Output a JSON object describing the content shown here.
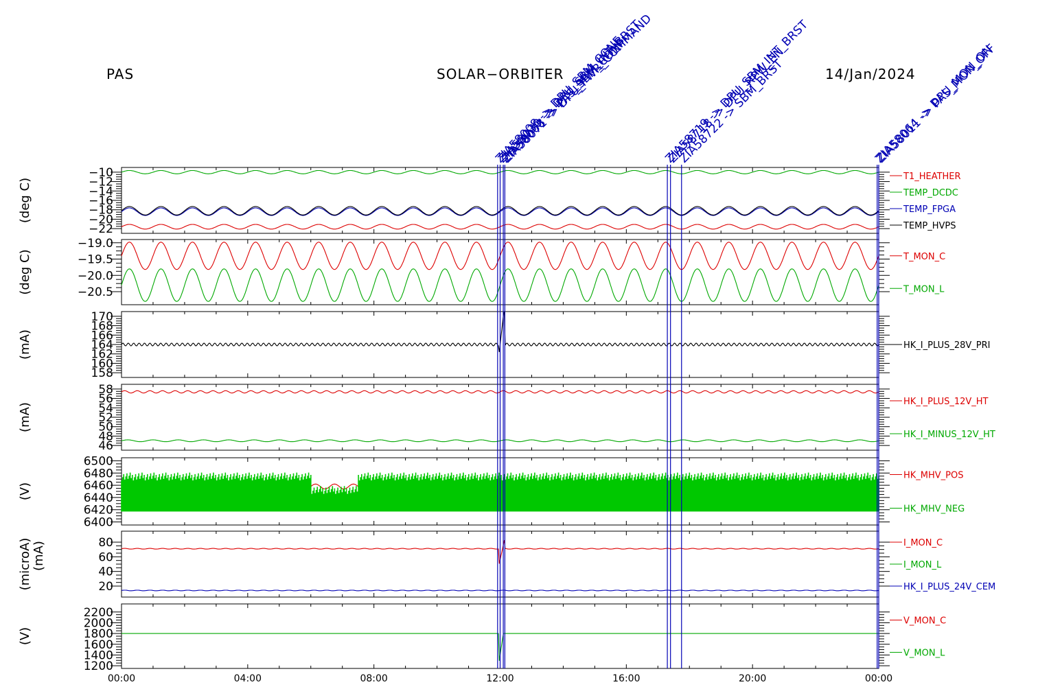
{
  "header": {
    "instrument": "PAS",
    "mission": "SOLAR−ORBITER",
    "date": "14/Jan/2024"
  },
  "colors": {
    "red": "#dd0000",
    "green": "#00a800",
    "blue": "#0000b4",
    "black": "#000000",
    "fill_green": "#00c800"
  },
  "chart_data": {
    "type": "line",
    "x_axis": {
      "ticks": [
        "00:00",
        "04:00",
        "08:00",
        "12:00",
        "16:00",
        "20:00",
        "00:00"
      ],
      "range_hours": [
        0,
        24
      ]
    },
    "events": [
      {
        "hour": 11.92,
        "label": "ZIA58008 -> DPU_SBM_CONF"
      },
      {
        "hour": 12.0,
        "label": "ZIA58030 -> DPU_SBM_INT_BRST"
      },
      {
        "hour": 12.1,
        "label": "ZIA58068 -> PAS_SBM_CONF"
      },
      {
        "hour": 12.15,
        "label": "ZIA58071 -> DPU_PWR_COMMAND"
      },
      {
        "hour": 17.3,
        "label": "ZIA58719 -> DPU_SBM_INT_BRST"
      },
      {
        "hour": 17.4,
        "label": "ZIA58718 -> DPU_RPW_EN"
      },
      {
        "hour": 17.75,
        "label": "ZIA58722 -> SBM_BRST"
      },
      {
        "hour": 23.95,
        "label": "ZIA58064 -> DPU_MON_ON"
      },
      {
        "hour": 24.0,
        "label": "ZIA58011 -> PAS_MON_OFF"
      }
    ],
    "panels": [
      {
        "ylabel": "(deg C)",
        "ylim": [
          -23,
          -9
        ],
        "yticks": [
          "−10",
          "−12",
          "−14",
          "−16",
          "−18",
          "−20",
          "−22"
        ],
        "series": [
          {
            "name": "T1_HEATHER",
            "color": "red",
            "mean": -21.6,
            "amp": 0.5,
            "cycles": 24
          },
          {
            "name": "TEMP_DCDC",
            "color": "green",
            "mean": -10.0,
            "amp": 0.35,
            "cycles": 24
          },
          {
            "name": "TEMP_FPGA",
            "color": "blue",
            "mean": -18.4,
            "amp": 0.8,
            "cycles": 24
          },
          {
            "name": "TEMP_HVPS",
            "color": "black",
            "mean": -18.2,
            "amp": 0.9,
            "cycles": 24
          }
        ]
      },
      {
        "ylabel": "(deg C)",
        "ylim": [
          -20.9,
          -18.9
        ],
        "yticks": [
          "−19.0",
          "−19.5",
          "−20.0",
          "−20.5"
        ],
        "series": [
          {
            "name": "T_MON_C",
            "color": "red",
            "mean": -19.4,
            "amp": 0.42,
            "cycles": 24
          },
          {
            "name": "T_MON_L",
            "color": "green",
            "mean": -20.3,
            "amp": 0.5,
            "cycles": 24
          }
        ]
      },
      {
        "ylabel": "(mA)",
        "ylim": [
          157,
          171
        ],
        "yticks": [
          "170",
          "168",
          "166",
          "164",
          "162",
          "160",
          "158"
        ],
        "series": [
          {
            "name": "HK_I_PLUS_28V_PRI",
            "color": "black",
            "mean": 164.0,
            "amp": 0.3,
            "cycles": 140
          }
        ]
      },
      {
        "ylabel": "(mA)",
        "ylim": [
          45,
          59
        ],
        "yticks": [
          "58",
          "56",
          "54",
          "52",
          "50",
          "48",
          "46"
        ],
        "series": [
          {
            "name": "HK_I_PLUS_12V_HT",
            "color": "red",
            "mean": 57.4,
            "amp": 0.25,
            "cycles": 60
          },
          {
            "name": "HK_I_MINUS_12V_HT",
            "color": "green",
            "mean": 47.0,
            "amp": 0.2,
            "cycles": 30
          }
        ]
      },
      {
        "ylabel": "(V)",
        "ylim": [
          6395,
          6505
        ],
        "yticks": [
          "6500",
          "6480",
          "6460",
          "6440",
          "6420",
          "6400"
        ],
        "series": [
          {
            "name": "HK_MHV_POS",
            "color": "red",
            "mean": 6458,
            "amp": 4,
            "cycles": 40
          },
          {
            "name": "HK_MHV_NEG",
            "color": "green",
            "low": 6417,
            "high": 6468,
            "cycles": 0
          }
        ]
      },
      {
        "ylabel": "(microA)",
        "ylabel2": "(mA)",
        "ylim": [
          5,
          95
        ],
        "yticks": [
          "80",
          "60",
          "40",
          "20"
        ],
        "series": [
          {
            "name": "I_MON_C",
            "color": "red",
            "mean": 71,
            "amp": 0.5,
            "cycles": 60
          },
          {
            "name": "I_MON_L",
            "color": "green",
            "mean": null,
            "amp": 0,
            "cycles": 0
          },
          {
            "name": "HK_I_PLUS_24V_CEM",
            "color": "blue",
            "mean": 14,
            "amp": 0.4,
            "cycles": 60
          }
        ]
      },
      {
        "ylabel": "(V)",
        "ylim": [
          1150,
          2350
        ],
        "yticks": [
          "2200",
          "2000",
          "1800",
          "1600",
          "1400",
          "1200"
        ],
        "series": [
          {
            "name": "V_MON_C",
            "color": "red",
            "mean": null,
            "amp": 0,
            "cycles": 0
          },
          {
            "name": "V_MON_L",
            "color": "green",
            "mean": 1800,
            "amp": 0,
            "cycles": 0
          }
        ]
      }
    ]
  }
}
